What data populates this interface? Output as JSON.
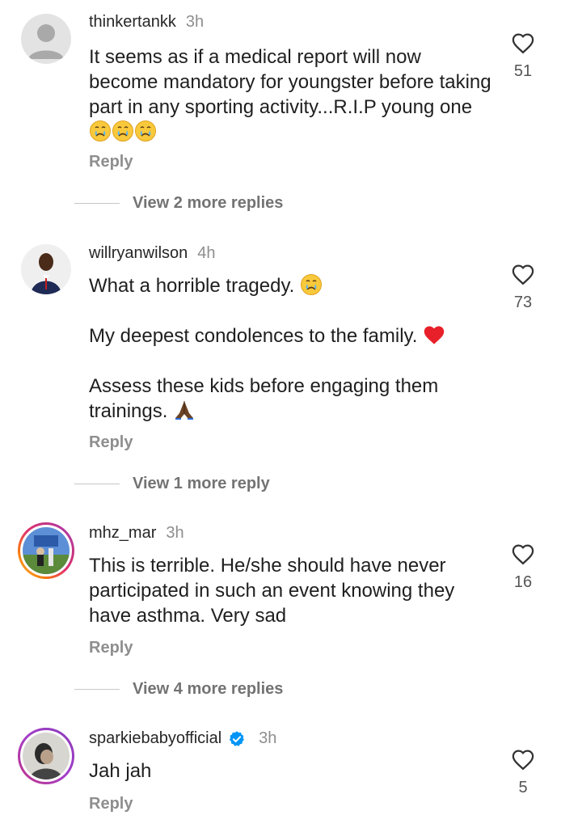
{
  "comments": [
    {
      "username": "thinkertankk",
      "time": "3h",
      "text": "It seems as if a medical report will now become mandatory for youngster before taking part in any sporting activity...R.I.P young one",
      "emojis": [
        "crying-face",
        "crying-face",
        "crying-face"
      ],
      "likes": "51",
      "reply_label": "Reply",
      "more_replies": "View 2 more replies"
    },
    {
      "username": "willryanwilson",
      "time": "4h",
      "line1": "What a horrible tragedy.",
      "line1_emoji": "crying-face",
      "line2": "My deepest condolences to the family.",
      "line2_emoji": "red-heart",
      "line3": "Assess these kids before engaging them trainings.",
      "line3_emoji": "praying-hands",
      "likes": "73",
      "reply_label": "Reply",
      "more_replies": "View 1 more reply"
    },
    {
      "username": "mhz_mar",
      "time": "3h",
      "text": "This is terrible. He/she should have never participated in such an event knowing they have asthma. Very sad",
      "likes": "16",
      "reply_label": "Reply",
      "more_replies": "View 4 more replies"
    },
    {
      "username": "sparkiebabyofficial",
      "time": "3h",
      "verified": true,
      "text": "Jah jah",
      "likes": "5",
      "reply_label": "Reply"
    }
  ],
  "colors": {
    "username": "#262626",
    "muted": "#8e8e8e",
    "verified": "#0095f6",
    "story_ring": "#e1306c"
  },
  "icons": {
    "like": "heart-outline-icon",
    "verified": "verified-badge-icon"
  }
}
